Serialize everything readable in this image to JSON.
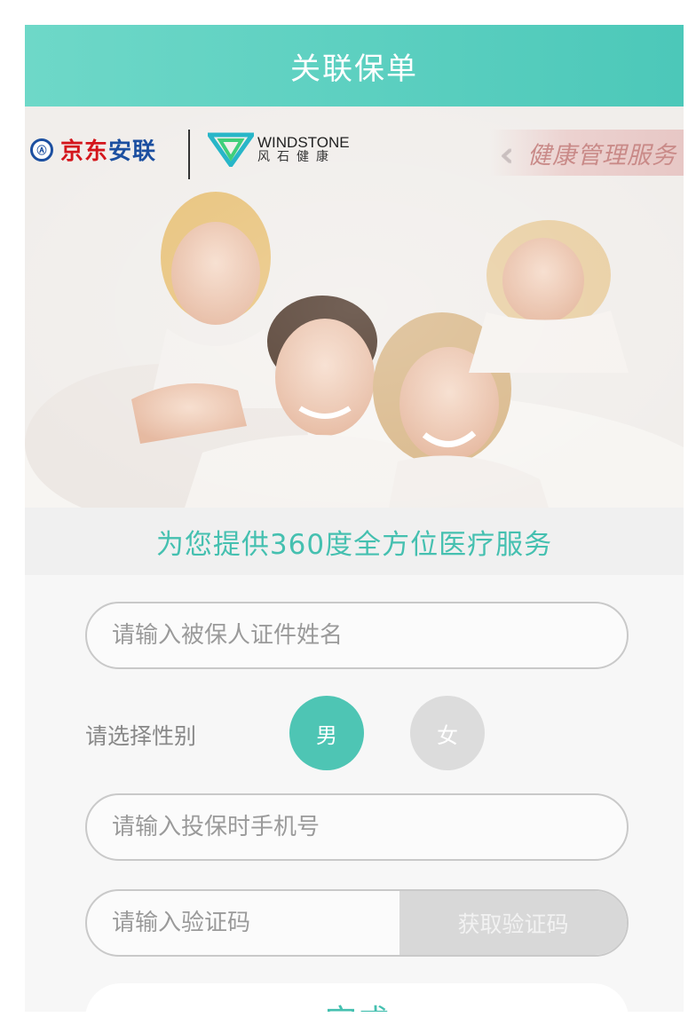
{
  "header": {
    "title": "关联保单"
  },
  "banner": {
    "jd_logo_red": "京东",
    "jd_logo_blue": "安联",
    "windstone_en": "WINDSTONE",
    "windstone_cn": "风石健康",
    "tag": "健康管理服务"
  },
  "slogan": "为您提供360度全方位医疗服务",
  "form": {
    "name_placeholder": "请输入被保人证件姓名",
    "gender_label": "请选择性别",
    "gender_male": "男",
    "gender_female": "女",
    "gender_selected": "男",
    "phone_placeholder": "请输入投保时手机号",
    "code_placeholder": "请输入验证码",
    "get_code": "获取验证码",
    "submit": "完成"
  },
  "colors": {
    "accent": "#4ec5b4",
    "header_gradient_start": "#6ed8c8",
    "header_gradient_end": "#4cc8b9",
    "disabled": "#d8d8d8"
  }
}
